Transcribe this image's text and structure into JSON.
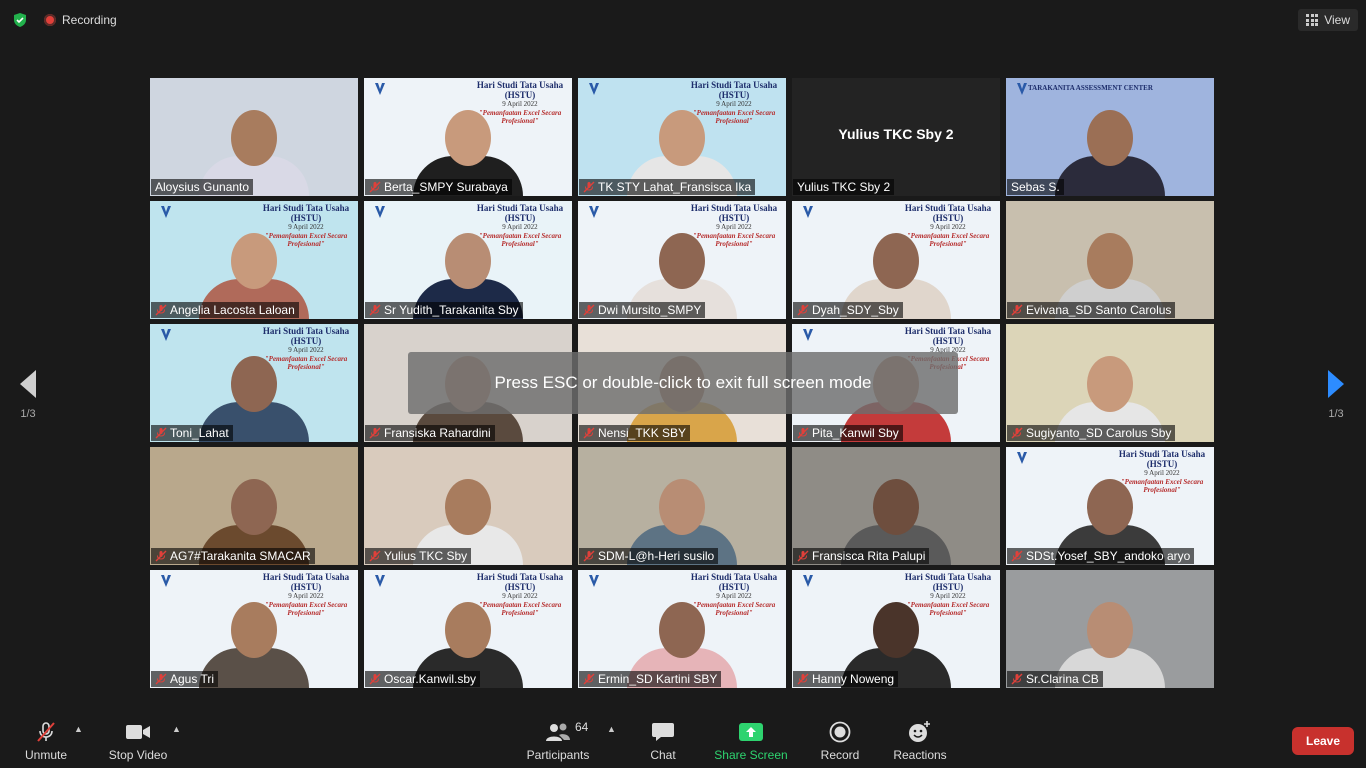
{
  "topbar": {
    "recording_label": "Recording",
    "view_label": "View"
  },
  "banner": {
    "title": "Hari Studi Tata Usaha",
    "subtitle": "(HSTU)",
    "date": "9 April 2022",
    "theme": "\"Pemanfaatan Excel Secara Profesional\""
  },
  "tac_text": "TARAKANITA ASSESSMENT CENTER",
  "participants_tiles": [
    {
      "name": "Aloysius Gunanto",
      "muted": false
    },
    {
      "name": "Berta_SMPY Surabaya",
      "muted": true
    },
    {
      "name": "TK STY Lahat_Fransisca Ika",
      "muted": true
    },
    {
      "name": "Yulius TKC Sby 2",
      "muted": false,
      "center": "Yulius TKC Sby 2"
    },
    {
      "name": "Sebas S.",
      "muted": false
    },
    {
      "name": "Angelia Lacosta Laloan",
      "muted": true
    },
    {
      "name": "Sr Yudith_Tarakanita Sby",
      "muted": true,
      "active": true
    },
    {
      "name": "Dwi Mursito_SMPY",
      "muted": true
    },
    {
      "name": "Dyah_SDY_Sby",
      "muted": true
    },
    {
      "name": "Evivana_SD Santo Carolus",
      "muted": true
    },
    {
      "name": "Toni_Lahat",
      "muted": true
    },
    {
      "name": "Fransiska Rahardini",
      "muted": true
    },
    {
      "name": "Nensi_TKK SBY",
      "muted": true
    },
    {
      "name": "Pita_Kanwil Sby",
      "muted": true
    },
    {
      "name": "Sugiyanto_SD Carolus Sby",
      "muted": true
    },
    {
      "name": "AG7#Tarakanita SMACAR",
      "muted": true
    },
    {
      "name": "Yulius TKC Sby",
      "muted": true
    },
    {
      "name": "SDM-L@h-Heri susilo",
      "muted": true
    },
    {
      "name": "Fransisca Rita Palupi",
      "muted": true
    },
    {
      "name": "SDSt.Yosef_SBY_andoko aryo",
      "muted": true
    },
    {
      "name": "Agus Tri",
      "muted": true
    },
    {
      "name": "Oscar.Kanwil.sby",
      "muted": true
    },
    {
      "name": "Ermin_SD Kartini SBY",
      "muted": true
    },
    {
      "name": "Hanny Noweng",
      "muted": true
    },
    {
      "name": "Sr.Clarina CB",
      "muted": true
    }
  ],
  "toast": "Press ESC or double-click to exit full screen mode",
  "pager": {
    "left": "1/3",
    "right": "1/3"
  },
  "toolbar": {
    "unmute": "Unmute",
    "stop_video": "Stop Video",
    "participants": "Participants",
    "participant_count": "64",
    "chat": "Chat",
    "share_screen": "Share Screen",
    "record": "Record",
    "reactions": "Reactions",
    "leave": "Leave"
  },
  "colors": {
    "background": "#1a1a1a",
    "active_speaker": "#d9e04a",
    "share_green": "#2ed36f",
    "leave_red": "#c8312d"
  }
}
